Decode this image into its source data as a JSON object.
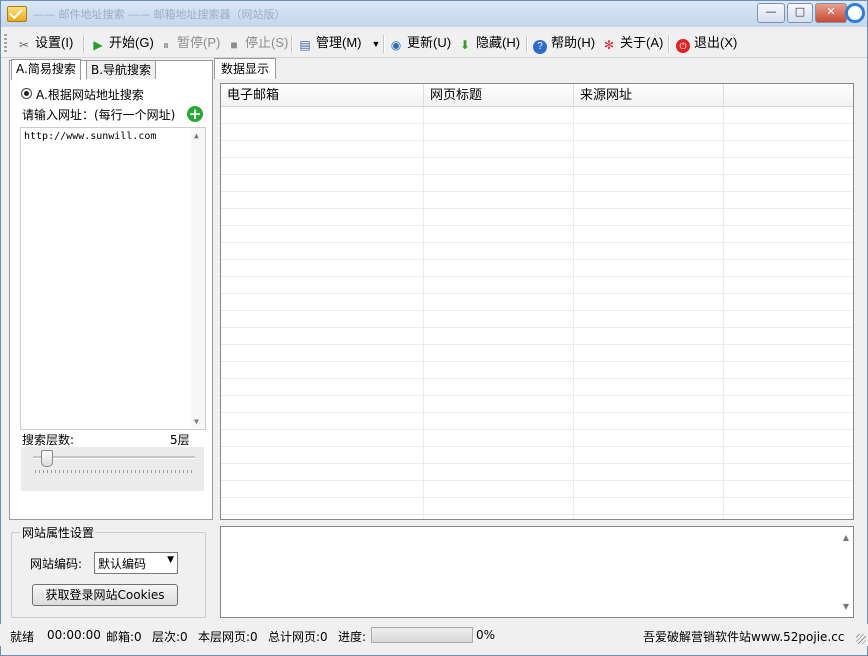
{
  "window": {
    "title": "—— 邮件地址搜索 —— 邮箱地址搜索器（网站版）"
  },
  "toolbar": {
    "settings": "设置(I)",
    "start": "开始(G)",
    "pause": "暂停(P)",
    "stop": "停止(S)",
    "manage": "管理(M)",
    "update": "更新(U)",
    "hide": "隐藏(H)",
    "help": "帮助(H)",
    "about": "关于(A)",
    "exit": "退出(X)"
  },
  "left": {
    "tabs": [
      "A.简易搜索",
      "B.导航搜索"
    ],
    "radio_label": "A.根据网站地址搜索",
    "url_prompt": "请输入网址：(每行一个网址)",
    "url_value": "http://www.sunwill.com",
    "depth_label": "搜索层数:",
    "depth_value": "5层",
    "depth_level": 1
  },
  "site_settings": {
    "title": "网站属性设置",
    "encoding_label": "网站编码:",
    "encoding_value": "默认编码",
    "cookies_button": "获取登录网站Cookies"
  },
  "right": {
    "tab": "数据显示",
    "columns": [
      "电子邮箱",
      "网页标题",
      "来源网址",
      ""
    ]
  },
  "status": {
    "state": "就绪",
    "time": "00:00:00",
    "email": "邮箱:0",
    "level": "层次:0",
    "page_this_level": "本层网页:0",
    "pages_total": "总计网页:0",
    "progress_label": "进度:",
    "progress_value": 0,
    "progress_text": "0%",
    "credit": "吾爱破解营销软件站www.52pojie.cc"
  }
}
